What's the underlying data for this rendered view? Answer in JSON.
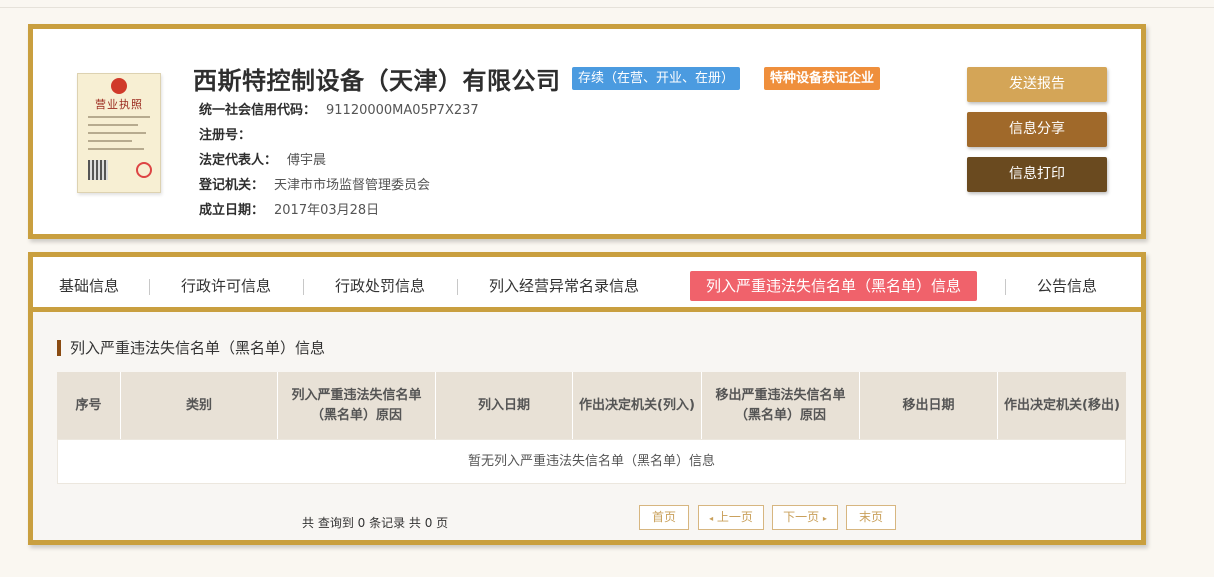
{
  "company": {
    "name": "西斯特控制设备（天津）有限公司",
    "status_badge": "存续（在营、开业、在册）",
    "special_badge": "特种设备获证企业",
    "license_image": {
      "title": "营业执照"
    },
    "fields": [
      {
        "label": "统一社会信用代码：",
        "value": "91120000MA05P7X237"
      },
      {
        "label": "注册号：",
        "value": ""
      },
      {
        "label": "法定代表人：",
        "value": "傅宇晨"
      },
      {
        "label": "登记机关：",
        "value": "天津市市场监督管理委员会"
      },
      {
        "label": "成立日期：",
        "value": "2017年03月28日"
      }
    ]
  },
  "actions": {
    "send_report": "发送报告",
    "share": "信息分享",
    "print": "信息打印"
  },
  "tabs": [
    {
      "label": "基础信息"
    },
    {
      "label": "行政许可信息"
    },
    {
      "label": "行政处罚信息"
    },
    {
      "label": "列入经营异常名录信息"
    },
    {
      "label": "列入严重违法失信名单（黑名单）信息",
      "active": true
    },
    {
      "label": "公告信息"
    }
  ],
  "section": {
    "title": "列入严重违法失信名单（黑名单）信息",
    "columns": [
      "序号",
      "类别",
      "列入严重违法失信名单（黑名单）原因",
      "列入日期",
      "作出决定机关(列入)",
      "移出严重违法失信名单（黑名单）原因",
      "移出日期",
      "作出决定机关(移出)"
    ],
    "empty_message": "暂无列入严重违法失信名单（黑名单）信息"
  },
  "pagination": {
    "summary": "共 查询到 0 条记录 共 0 页",
    "first": "首页",
    "prev": "上一页",
    "next": "下一页",
    "last": "末页"
  },
  "colors": {
    "gold_border": "#c99f3f",
    "status_blue": "#4b9be0",
    "special_orange": "#ef8f3c",
    "active_tab": "#f0626b",
    "btn_report": "#d4a557",
    "btn_share": "#a0692a",
    "btn_print": "#6a4a1f"
  }
}
